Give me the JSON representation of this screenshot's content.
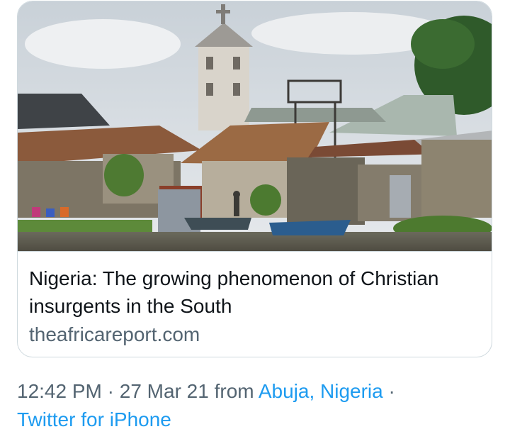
{
  "card": {
    "image_alt": "Waterfront village with stilt houses and rusted tin roofs beside a church bell tower topped by a cross",
    "title": "Nigeria: The growing phenomenon of Christian insurgents in the South",
    "domain": "theafricareport.com"
  },
  "tweet_meta": {
    "time": "12:42 PM",
    "separator_1": " · ",
    "date": "27 Mar 21",
    "from_text": " from ",
    "location": "Abuja, Nigeria",
    "separator_2": " · ",
    "source": "Twitter for iPhone"
  },
  "colors": {
    "link": "#1d9bf0",
    "secondary_text": "#536471",
    "primary_text": "#0f1419",
    "border": "#cfd9de"
  }
}
